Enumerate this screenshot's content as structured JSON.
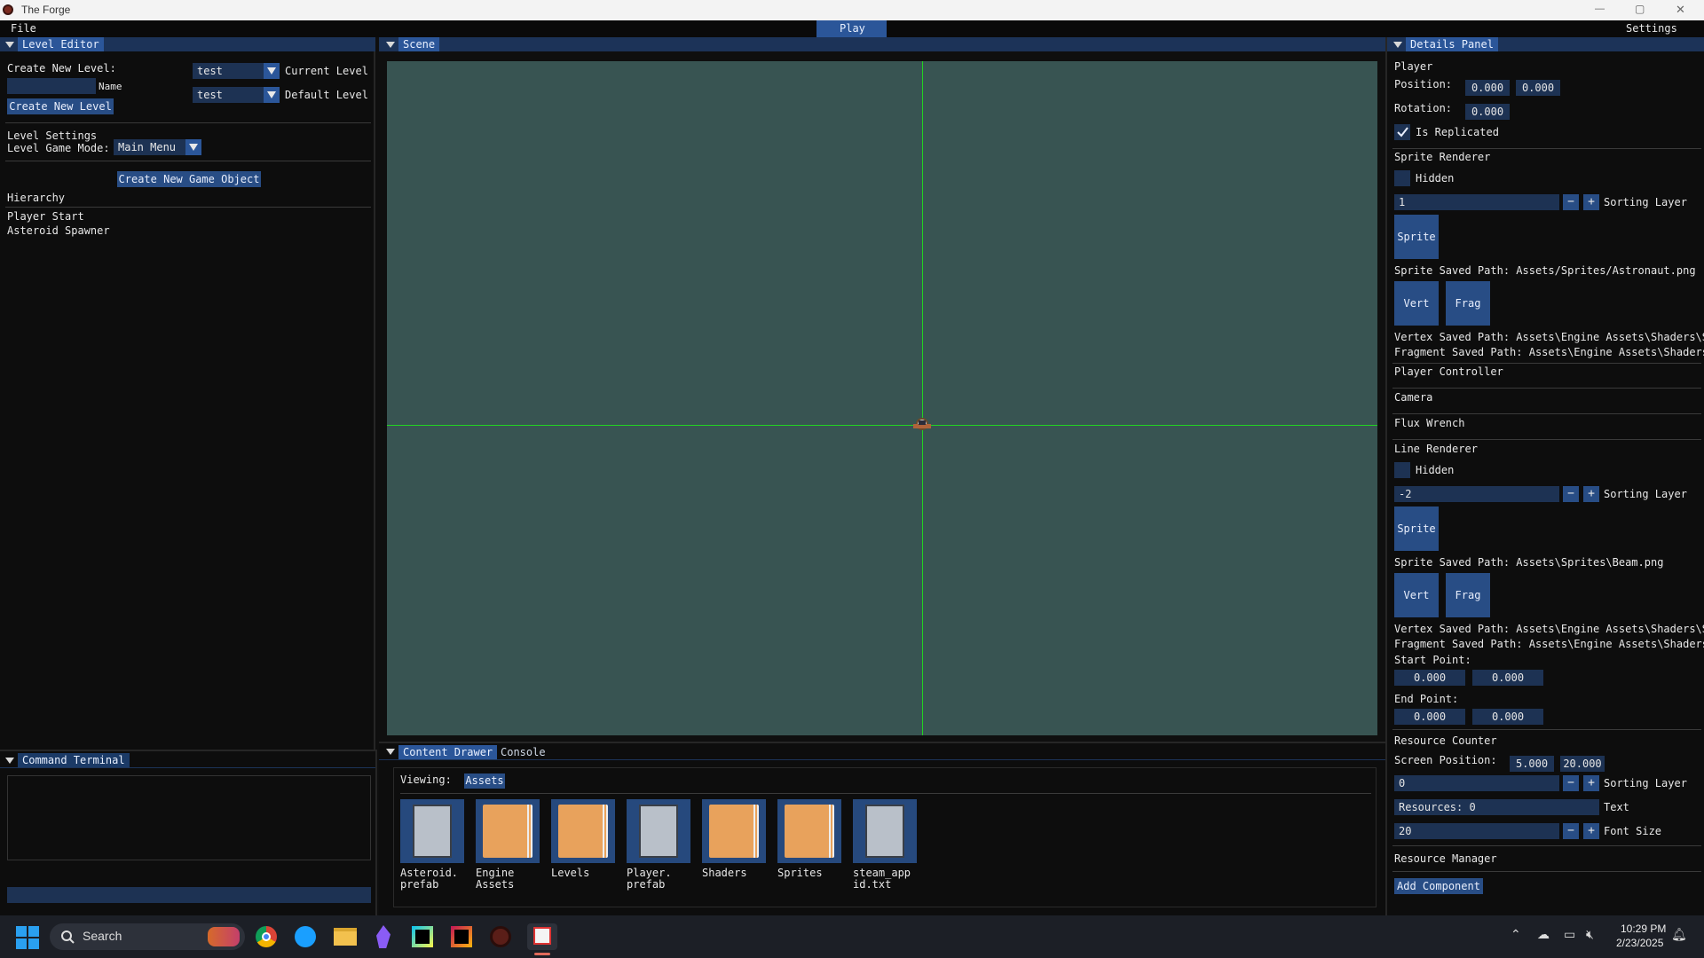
{
  "window": {
    "title": "The Forge",
    "minimize": "—",
    "maximize": "▢",
    "close": "✕"
  },
  "menu": {
    "file": "File",
    "play": "Play",
    "settings": "Settings"
  },
  "level_editor": {
    "tab": "Level Editor",
    "create_new_level_label": "Create New Level:",
    "name_label": "Name",
    "name_value": "",
    "create_button": "Create New Level",
    "current_level_value": "test",
    "current_level_label": "Current Level",
    "default_level_value": "test",
    "default_level_label": "Default Level",
    "level_settings": "Level Settings",
    "game_mode_label": "Level Game Mode:",
    "game_mode_value": "Main Menu",
    "create_object_button": "Create New Game Object",
    "hierarchy": "Hierarchy",
    "hierarchy_items": [
      "Player Start",
      "Asteroid Spawner"
    ]
  },
  "command_terminal": {
    "tab": "Command Terminal",
    "input": ""
  },
  "scene": {
    "tab": "Scene",
    "background": "#385452",
    "axis_color": "#22d322"
  },
  "content": {
    "tab_drawer": "Content Drawer",
    "tab_console": "Console",
    "viewing_label": "Viewing:",
    "viewing_value": "Assets",
    "assets": [
      {
        "type": "file",
        "name": "Asteroid.\nprefab"
      },
      {
        "type": "folder",
        "name": "Engine\nAssets"
      },
      {
        "type": "folder",
        "name": "Levels"
      },
      {
        "type": "file",
        "name": "Player.\nprefab"
      },
      {
        "type": "folder",
        "name": "Shaders"
      },
      {
        "type": "folder",
        "name": "Sprites"
      },
      {
        "type": "file",
        "name": "steam_app\nid.txt"
      }
    ]
  },
  "details": {
    "tab": "Details Panel",
    "player": "Player",
    "position_label": "Position:",
    "position_x": "0.000",
    "position_y": "0.000",
    "rotation_label": "Rotation:",
    "rotation": "0.000",
    "is_replicated": "Is Replicated",
    "sprite_renderer": "Sprite Renderer",
    "hidden": "Hidden",
    "sorting_layer": "Sorting Layer",
    "sprite_layer_value": "1",
    "sprite_button": "Sprite",
    "sprite_saved_path": "Sprite Saved Path: Assets/Sprites/Astronaut.png",
    "vert": "Vert",
    "frag": "Frag",
    "vertex_saved_path": "Vertex Saved Path: Assets\\Engine Assets\\Shaders\\Sp",
    "fragment_saved_path": "Fragment Saved Path: Assets\\Engine Assets\\Shaders\\",
    "player_controller": "Player Controller",
    "camera": "Camera",
    "flux_wrench": "Flux Wrench",
    "line_renderer": "Line Renderer",
    "line_layer_value": "-2",
    "line_sprite_saved_path": "Sprite Saved Path: Assets\\Sprites\\Beam.png",
    "start_point_label": "Start Point:",
    "start_x": "0.000",
    "start_y": "0.000",
    "end_point_label": "End Point:",
    "end_x": "0.000",
    "end_y": "0.000",
    "resource_counter": "Resource Counter",
    "screen_position_label": "Screen Position:",
    "screen_x": "5.000",
    "screen_y": "20.000",
    "rc_layer_value": "0",
    "text_value": "Resources: 0",
    "text_label": "Text",
    "font_size_value": "20",
    "font_size_label": "Font Size",
    "resource_manager": "Resource Manager",
    "add_component": "Add Component",
    "minus": "−",
    "plus": "+"
  },
  "taskbar": {
    "search": "Search",
    "time": "10:29 PM",
    "date": "2/23/2025"
  }
}
